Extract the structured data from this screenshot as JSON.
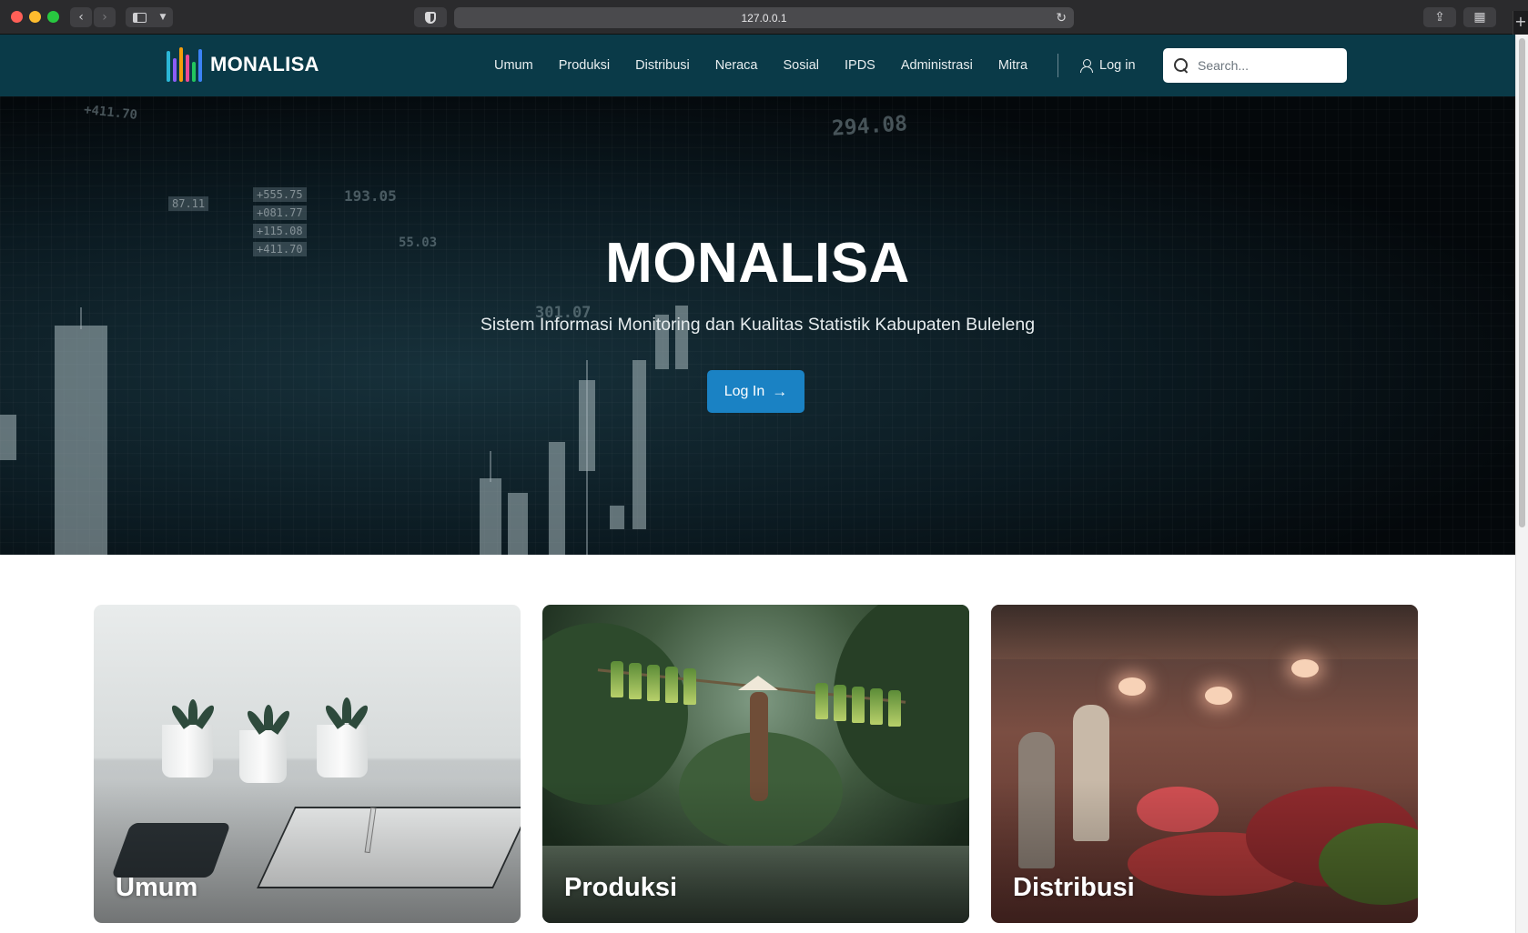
{
  "browser": {
    "url": "127.0.0.1"
  },
  "navbar": {
    "brand": "MONALISA",
    "links": [
      "Umum",
      "Produksi",
      "Distribusi",
      "Neraca",
      "Sosial",
      "IPDS",
      "Administrasi",
      "Mitra"
    ],
    "login": "Log in",
    "search_placeholder": "Search..."
  },
  "hero": {
    "title": "MONALISA",
    "subtitle": "Sistem Informasi Monitoring dan Kualitas Statistik Kabupaten Buleleng",
    "button": "Log In",
    "ticker_values": [
      "+411.70",
      "294.08",
      "193.05",
      "+555.75",
      "+081.77",
      "+115.08",
      "+411.70",
      "55.03",
      "87.11",
      "301.07"
    ]
  },
  "cards": [
    "Umum",
    "Produksi",
    "Distribusi"
  ],
  "colors": {
    "navbar_bg": "#0a3a48",
    "button_primary": "#1a82c4",
    "logo_bars": [
      "#2bb6d6",
      "#8b5cf6",
      "#f59e0b",
      "#ec4899",
      "#22c55e",
      "#3b82f6"
    ]
  }
}
